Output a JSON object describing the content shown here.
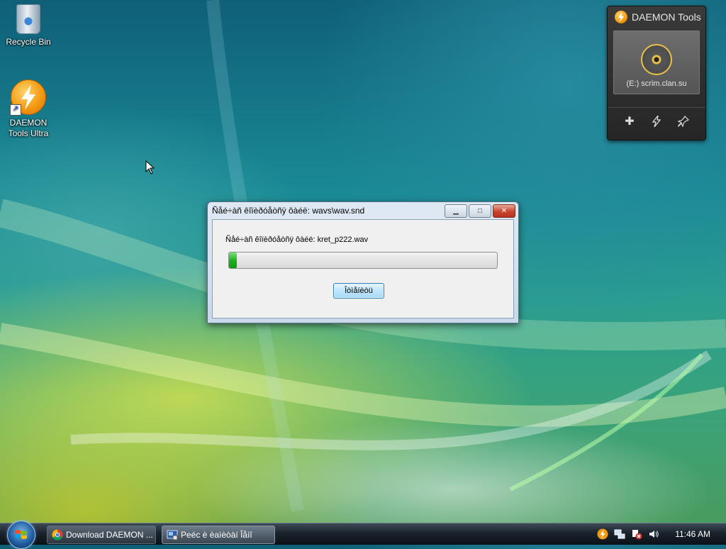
{
  "desktop": {
    "icons": [
      {
        "label": "Recycle Bin"
      },
      {
        "label": "DAEMON Tools Ultra"
      }
    ]
  },
  "gadget": {
    "title": "DAEMON Tools",
    "drive_label": "(E:) scrim.clan.su",
    "tools": [
      "add-icon",
      "bolt-icon",
      "pin-icon"
    ]
  },
  "dialog": {
    "title": "Ñåé÷àñ êîïèðóåòñÿ ôàéë: wavs\\wav.snd",
    "status": "Ñåé÷àñ êîïèðóåòñÿ ôàéë: kret_p222.wav",
    "progress_fraction": 0.03,
    "cancel_label": "Îòìåíèòü"
  },
  "taskbar": {
    "buttons": [
      {
        "label": "Download DAEMON ..."
      },
      {
        "label": "Peéc è èaìèòàí Îåìî"
      }
    ],
    "clock": "11:46 AM"
  },
  "colors": {
    "progress_green": "#20b020",
    "daemon_orange": "#f39a12"
  }
}
